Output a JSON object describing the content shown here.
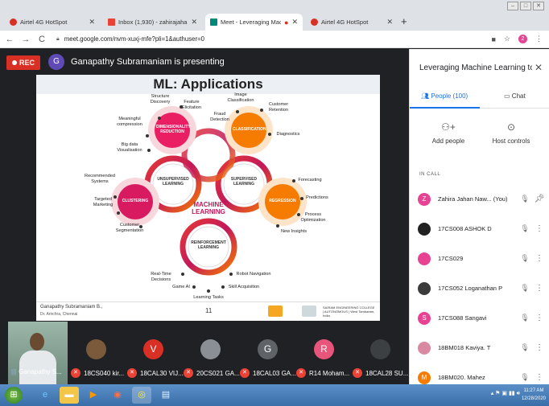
{
  "browser": {
    "tabs": [
      {
        "label": "Airtel 4G HotSpot",
        "icon": "airtel-icon",
        "active": false
      },
      {
        "label": "Inbox (1,930) - zahirajahan.nawaz",
        "icon": "gmail-icon",
        "active": false
      },
      {
        "label": "Meet - Leveraging Machine",
        "icon": "meet-icon",
        "active": true
      },
      {
        "label": "Airtel 4G HotSpot",
        "icon": "airtel-icon",
        "active": false
      }
    ],
    "url": "meet.google.com/nvm-xuxj-mfe?pli=1&authuser=0",
    "profile_initial": "2"
  },
  "meet": {
    "rec_label": "REC",
    "presenter_initial": "G",
    "presenting_text": "Ganapathy Subramaniam is presenting"
  },
  "slide": {
    "title": "ML: Applications",
    "center": "MACHINE LEARNING",
    "unsupervised": "UNSUPERVISED LEARNING",
    "supervised": "SUPERVISED LEARNING",
    "reinforcement": "REINFORCEMENT LEARNING",
    "dim_reduction": "DIMENSIONALITY REDUCTION",
    "classification": "CLASSIFICATION",
    "clustering": "CLUSTERING",
    "regression": "REGRESSION",
    "labels": {
      "structure_discovery": "Structure Discovery",
      "feature_elicitation": "Feature Elicitation",
      "meaningful_compression": "Meaningful compression",
      "big_data": "Big data Visualisation",
      "image_classification": "Image Classification",
      "customer_retention": "Customer Retention",
      "fraud_detection": "Fraud Detection",
      "diagnostics": "Diagnostics",
      "recommended_systems": "Recommended Systems",
      "targeted_marketing": "Targeted Marketing",
      "customer_segmentation": "Customer Segmentation",
      "forecasting": "Forecasting",
      "predictions": "Predictions",
      "process_optimization": "Process Optimization",
      "new_insights": "New Insights",
      "real_time_decisions": "Real-Time Decisions",
      "robot_navigation": "Robot Navigation",
      "game_ai": "Game AI",
      "skill_acquisition": "Skill Acquisition",
      "learning_tasks": "Learning Tasks"
    },
    "footer_presenter": "Ganapathy Subramaniam B.,",
    "footer_sub": "Dr. Arirchra, Chennai",
    "page_number": "11",
    "footer_institute": "SAIRAM ENGINEERING COLLEGE | AUTONOMOUS | West Tambaram, India"
  },
  "participants_strip": [
    {
      "name": "Ganapathy S...",
      "initial": "",
      "color": "#6f8a7e",
      "self": true
    },
    {
      "name": "18CS040 kir...",
      "initial": "",
      "color": "#7a5a3a"
    },
    {
      "name": "18CAL30 VIJ...",
      "initial": "V",
      "color": "#d93025"
    },
    {
      "name": "20CS021 GA...",
      "initial": "",
      "color": "#8a8f95"
    },
    {
      "name": "18CAL03 GA...",
      "initial": "G",
      "color": "#5f6368"
    },
    {
      "name": "R14 Moham...",
      "initial": "R",
      "color": "#e8557a"
    },
    {
      "name": "18CAL28 SU...",
      "initial": "",
      "color": "#3c4043"
    }
  ],
  "panel": {
    "title": "Leveraging Machine Learning to ...",
    "people_tab": "People (100)",
    "chat_tab": "Chat",
    "add_people": "Add people",
    "host_controls": "Host controls",
    "in_call_label": "IN CALL",
    "people": [
      {
        "name": "Zahira Jahan Naw... (You)",
        "initial": "Z",
        "color": "#e84393",
        "you": true
      },
      {
        "name": "17CS008 ASHOK D",
        "initial": "",
        "color": "#222222"
      },
      {
        "name": "17CS029",
        "initial": "",
        "color": "#e84393"
      },
      {
        "name": "17CS052 Loganathan P",
        "initial": "",
        "color": "#3c3c3c"
      },
      {
        "name": "17CS088 Sangavi",
        "initial": "S",
        "color": "#e84393"
      },
      {
        "name": "18BM018 Kaviya. T",
        "initial": "",
        "color": "#d98aa0"
      },
      {
        "name": "18BM020. Mahez",
        "initial": "M",
        "color": "#f57c00"
      }
    ]
  },
  "taskbar": {
    "time": "11:27 AM",
    "date": "12/28/2020"
  }
}
